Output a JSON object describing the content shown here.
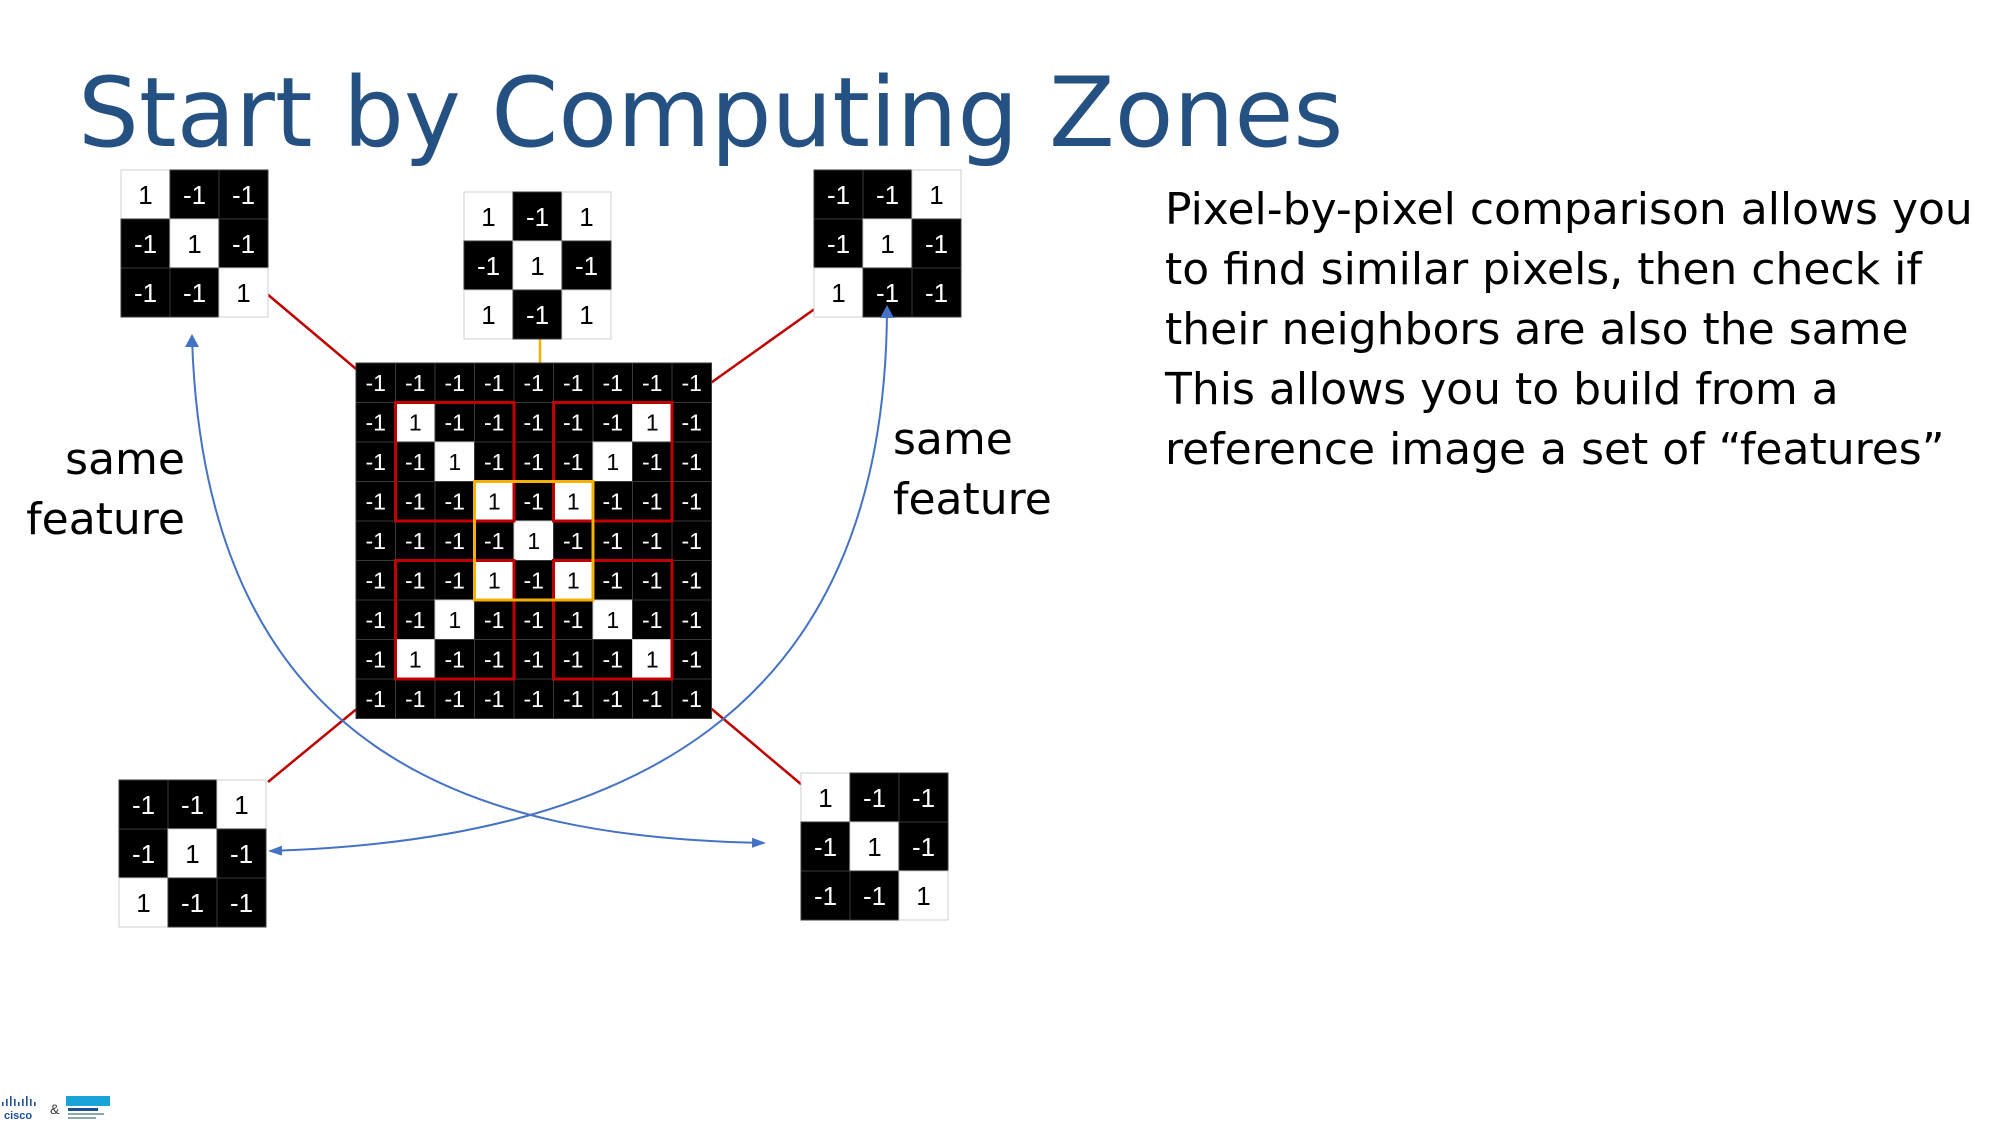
{
  "title": "Start by Computing Zones",
  "description": [
    "Pixel-by-pixel comparison allows you",
    "to find similar pixels, then check if",
    "their neighbors are also the same",
    "This allows you to build from a",
    "reference image a set of “features”"
  ],
  "labels": {
    "left": [
      "same",
      "feature"
    ],
    "right": [
      "same",
      "feature"
    ]
  },
  "main_grid": [
    [
      -1,
      -1,
      -1,
      -1,
      -1,
      -1,
      -1,
      -1,
      -1
    ],
    [
      -1,
      1,
      -1,
      -1,
      -1,
      -1,
      -1,
      1,
      -1
    ],
    [
      -1,
      -1,
      1,
      -1,
      -1,
      -1,
      1,
      -1,
      -1
    ],
    [
      -1,
      -1,
      -1,
      1,
      -1,
      1,
      -1,
      -1,
      -1
    ],
    [
      -1,
      -1,
      -1,
      -1,
      1,
      -1,
      -1,
      -1,
      -1
    ],
    [
      -1,
      -1,
      -1,
      1,
      -1,
      1,
      -1,
      -1,
      -1
    ],
    [
      -1,
      -1,
      1,
      -1,
      -1,
      -1,
      1,
      -1,
      -1
    ],
    [
      -1,
      1,
      -1,
      -1,
      -1,
      -1,
      -1,
      1,
      -1
    ],
    [
      -1,
      -1,
      -1,
      -1,
      -1,
      -1,
      -1,
      -1,
      -1
    ]
  ],
  "features": {
    "top_left": [
      [
        1,
        -1,
        -1
      ],
      [
        -1,
        1,
        -1
      ],
      [
        -1,
        -1,
        1
      ]
    ],
    "top_center": [
      [
        1,
        -1,
        1
      ],
      [
        -1,
        1,
        -1
      ],
      [
        1,
        -1,
        1
      ]
    ],
    "top_right": [
      [
        -1,
        -1,
        1
      ],
      [
        -1,
        1,
        -1
      ],
      [
        1,
        -1,
        -1
      ]
    ],
    "bottom_left": [
      [
        -1,
        -1,
        1
      ],
      [
        -1,
        1,
        -1
      ],
      [
        1,
        -1,
        -1
      ]
    ],
    "bottom_right": [
      [
        1,
        -1,
        -1
      ],
      [
        -1,
        1,
        -1
      ],
      [
        -1,
        -1,
        1
      ]
    ]
  },
  "logo": {
    "brand": "cisco",
    "separator": "&"
  },
  "colors": {
    "title": "#255182",
    "red_box": "#c00000",
    "orange_box": "#f5b000",
    "arrow": "#4472c4"
  }
}
